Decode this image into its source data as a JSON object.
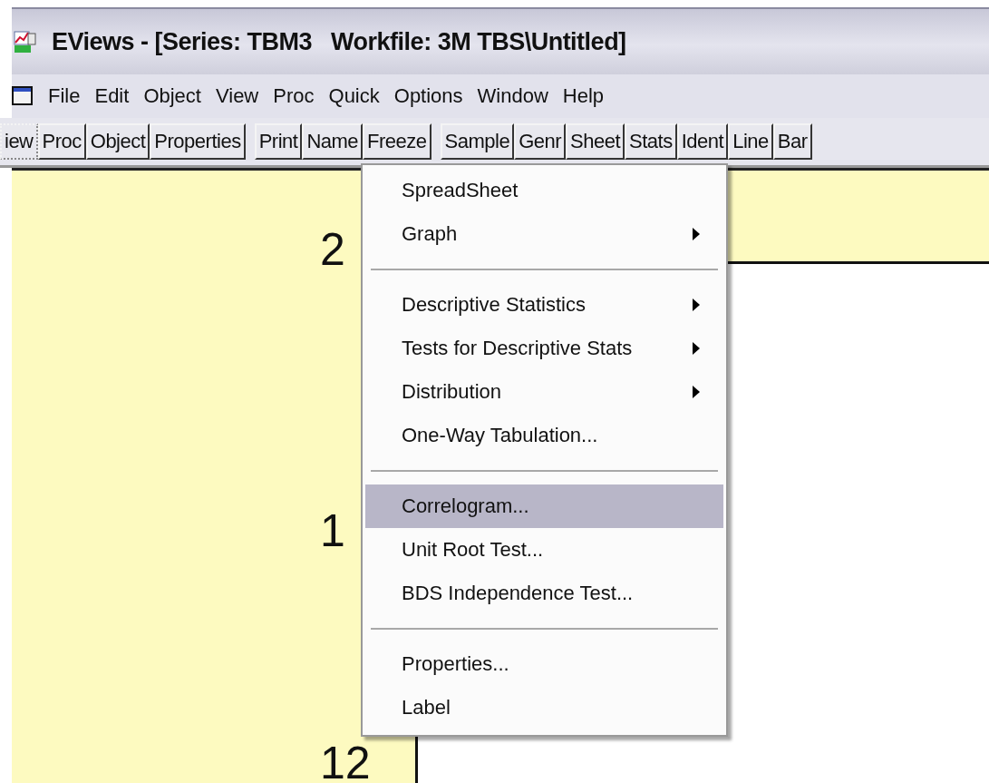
{
  "window": {
    "title": "EViews - [Series: TBM3   Workfile: 3M TBS\\Untitled]"
  },
  "menu_bar": [
    "File",
    "Edit",
    "Object",
    "View",
    "Proc",
    "Quick",
    "Options",
    "Window",
    "Help"
  ],
  "toolbar": {
    "groups": [
      [
        "iew",
        "Proc",
        "Object",
        "Properties"
      ],
      [
        "Print",
        "Name",
        "Freeze"
      ],
      [
        "Sample",
        "Genr",
        "Sheet",
        "Stats",
        "Ident",
        "Line",
        "Bar"
      ]
    ]
  },
  "graph": {
    "axis_labels": [
      "2",
      "1",
      "12"
    ]
  },
  "context_menu": {
    "sections": [
      [
        {
          "label": "SpreadSheet",
          "submenu": false,
          "selected": false
        },
        {
          "label": "Graph",
          "submenu": true,
          "selected": false
        }
      ],
      [
        {
          "label": "Descriptive Statistics",
          "submenu": true,
          "selected": false
        },
        {
          "label": "Tests for Descriptive Stats",
          "submenu": true,
          "selected": false
        },
        {
          "label": "Distribution",
          "submenu": true,
          "selected": false
        },
        {
          "label": "One-Way Tabulation...",
          "submenu": false,
          "selected": false
        }
      ],
      [
        {
          "label": "Correlogram...",
          "submenu": false,
          "selected": true
        },
        {
          "label": "Unit Root Test...",
          "submenu": false,
          "selected": false
        },
        {
          "label": "BDS Independence Test...",
          "submenu": false,
          "selected": false
        }
      ],
      [
        {
          "label": "Properties...",
          "submenu": false,
          "selected": false
        },
        {
          "label": "Label",
          "submenu": false,
          "selected": false
        }
      ]
    ]
  }
}
